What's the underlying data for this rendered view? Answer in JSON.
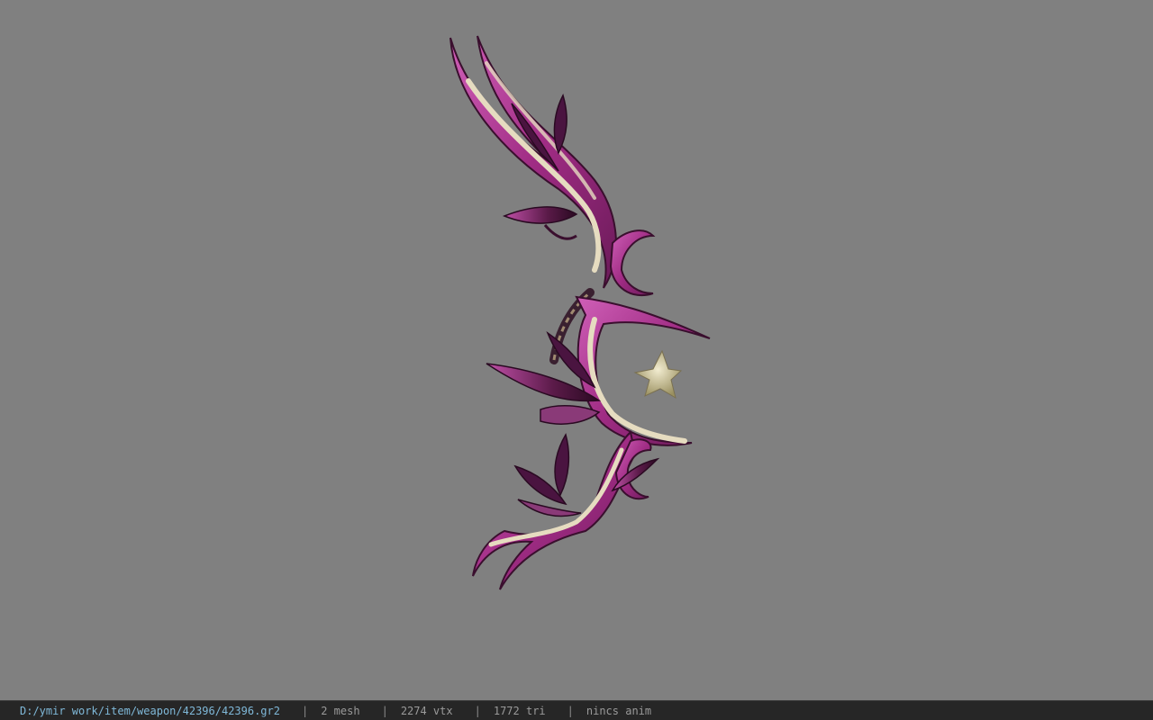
{
  "viewer": {
    "background_color": "#808080",
    "model_name": "bow-weapon-model"
  },
  "status_bar": {
    "path": "D:/ymir work/item/weapon/42396/42396.gr2",
    "separator": "|",
    "mesh": "2 mesh",
    "vertices": "2274 vtx",
    "triangles": "1772 tri",
    "anim": "nincs anim"
  },
  "colors": {
    "magenta": "#b0308f",
    "dark_purple": "#3a0f2e",
    "cream": "#e6dcc0",
    "gold": "#b8a070",
    "status_bg": "#262626",
    "path_text": "#7fb8d8"
  }
}
